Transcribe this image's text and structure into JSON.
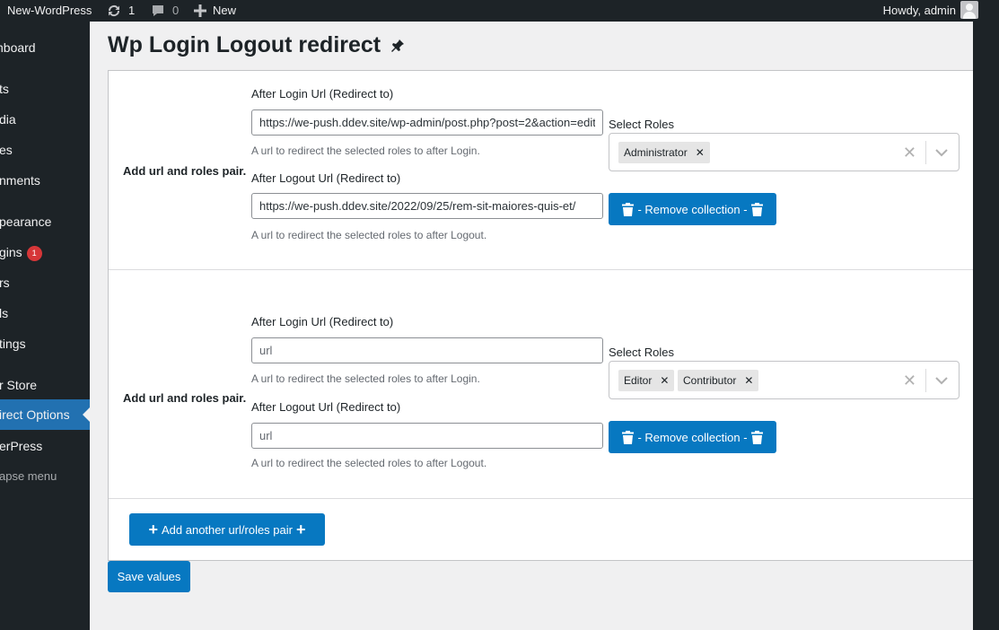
{
  "admin_bar": {
    "site_name": "New-WordPress",
    "updates_count": "1",
    "comments_count": "0",
    "new_label": "New",
    "howdy": "Howdy, admin"
  },
  "sidebar": {
    "items": [
      {
        "label": "hboard"
      },
      {
        "label": "ts"
      },
      {
        "label": "dia"
      },
      {
        "label": "es"
      },
      {
        "label": "nments"
      },
      {
        "label": "pearance"
      },
      {
        "label": "gins",
        "badge": "1"
      },
      {
        "label": "rs"
      },
      {
        "label": "ls"
      },
      {
        "label": "tings"
      },
      {
        "label": "r Store"
      },
      {
        "label": "irect Options"
      },
      {
        "label": "erPress"
      },
      {
        "label": "apse menu"
      }
    ]
  },
  "page": {
    "title": "Wp Login Logout redirect",
    "pin_icon": "admin-plugins-icon"
  },
  "pairs": [
    {
      "label": "Add url and roles pair.",
      "login_label": "After Login Url (Redirect to)",
      "login_value": "https://we-push.ddev.site/wp-admin/post.php?post=2&action=edit",
      "login_placeholder": "url",
      "login_desc": "A url to redirect the selected roles to after Login.",
      "logout_label": "After Logout Url (Redirect to)",
      "logout_value": "https://we-push.ddev.site/2022/09/25/rem-sit-maiores-quis-et/",
      "logout_placeholder": "url",
      "logout_desc": "A url to redirect the selected roles to after Logout.",
      "roles_label": "Select Roles",
      "roles": [
        "Administrator"
      ],
      "remove_label": "- Remove collection -"
    },
    {
      "label": "Add url and roles pair.",
      "login_label": "After Login Url (Redirect to)",
      "login_value": "",
      "login_placeholder": "url",
      "login_desc": "A url to redirect the selected roles to after Login.",
      "logout_label": "After Logout Url (Redirect to)",
      "logout_value": "",
      "logout_placeholder": "url",
      "logout_desc": "A url to redirect the selected roles to after Logout.",
      "roles_label": "Select Roles",
      "roles": [
        "Editor",
        "Contributor"
      ],
      "remove_label": "- Remove collection -"
    }
  ],
  "actions": {
    "add_pair_label": "Add another url/roles pair",
    "save_label": "Save values"
  },
  "colors": {
    "primary_button": "#0778c1",
    "admin_dark": "#1d2327",
    "menu_current": "#2271b1",
    "badge": "#d63638"
  }
}
